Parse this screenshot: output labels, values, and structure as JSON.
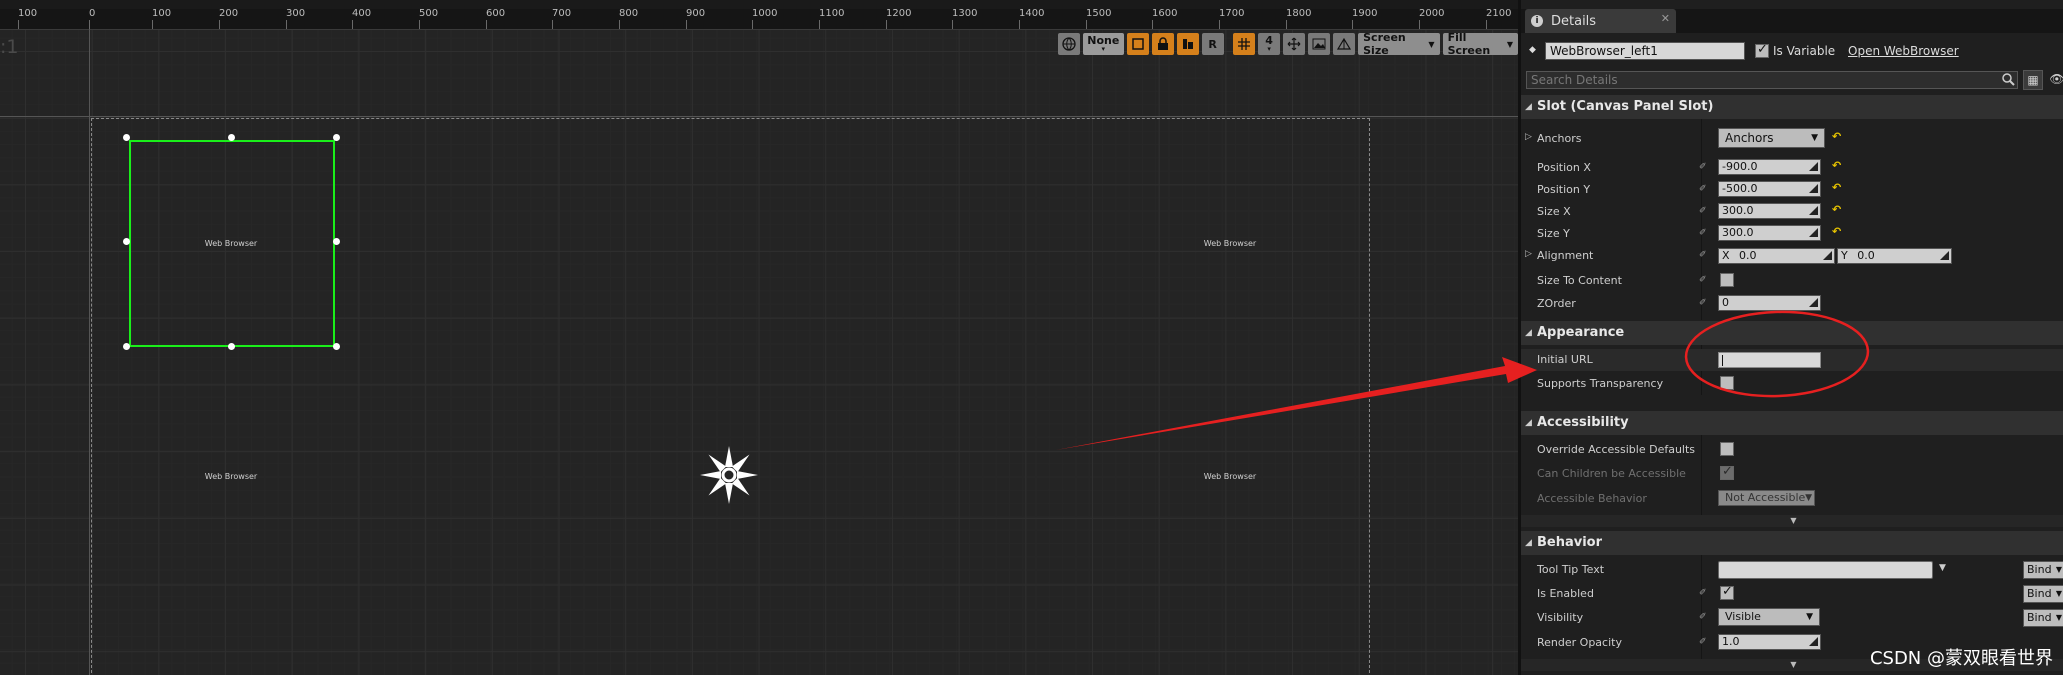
{
  "designer": {
    "corner_label": ":1",
    "ruler_ticks": [
      "100",
      "0",
      "100",
      "200",
      "300",
      "400",
      "500",
      "600",
      "700",
      "800",
      "900",
      "1000",
      "1100",
      "1200",
      "1300",
      "1400",
      "1500",
      "1600",
      "1700",
      "1800",
      "1900",
      "2000",
      "2100"
    ],
    "widget_labels": [
      "Web Browser",
      "Web Browser",
      "Web Browser",
      "Web Browser"
    ],
    "toolbar": {
      "none_label": "None",
      "r_label": "R",
      "grid_value": "4",
      "screen_size_label": "Screen Size",
      "fill_screen_label": "Fill Screen"
    }
  },
  "panel": {
    "tab_label": "Details",
    "widget_name": "WebBrowser_left1",
    "is_variable_label": "Is Variable",
    "is_variable_checked": true,
    "open_link": "Open WebBrowser",
    "search_placeholder": "Search Details",
    "sections": {
      "slot": "Slot (Canvas Panel Slot)",
      "appearance": "Appearance",
      "accessibility": "Accessibility",
      "behavior": "Behavior"
    },
    "slot": {
      "anchors_label": "Anchors",
      "anchors_value": "Anchors",
      "position_x_label": "Position X",
      "position_x": "-900.0",
      "position_y_label": "Position Y",
      "position_y": "-500.0",
      "size_x_label": "Size X",
      "size_x": "300.0",
      "size_y_label": "Size Y",
      "size_y": "300.0",
      "alignment_label": "Alignment",
      "alignment_x_prefix": "X",
      "alignment_x": "0.0",
      "alignment_y_prefix": "Y",
      "alignment_y": "0.0",
      "size_to_content_label": "Size To Content",
      "zorder_label": "ZOrder",
      "zorder": "0"
    },
    "appearance": {
      "initial_url_label": "Initial URL",
      "initial_url_value": "",
      "supports_transparency_label": "Supports Transparency"
    },
    "accessibility": {
      "override_label": "Override Accessible Defaults",
      "can_children_label": "Can Children be Accessible",
      "behavior_label": "Accessible Behavior",
      "behavior_value": "Not Accessible"
    },
    "behavior": {
      "tooltip_label": "Tool Tip Text",
      "tooltip_value": "",
      "is_enabled_label": "Is Enabled",
      "visibility_label": "Visibility",
      "visibility_value": "Visible",
      "render_opacity_label": "Render Opacity",
      "render_opacity": "1.0",
      "bind_label": "Bind"
    }
  },
  "watermark": "CSDN @蒙双眼看世界",
  "colors": {
    "selection_green": "#1aef1a",
    "annotation_red": "#e62020",
    "toolbar_orange": "#d5801b",
    "reset_yellow": "#e8c400"
  }
}
